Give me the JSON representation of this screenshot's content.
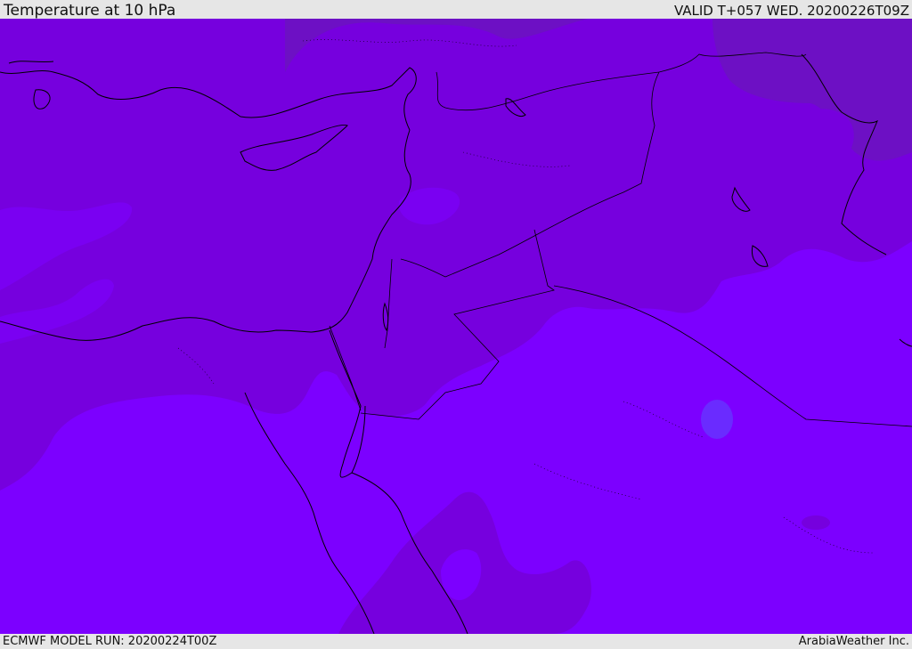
{
  "header": {
    "title": "Temperature at 10 hPa",
    "valid": "VALID T+057 WED. 20200226T09Z"
  },
  "footer": {
    "model_run": "ECMWF MODEL RUN: 20200224T00Z",
    "credit": "ArabiaWeather Inc."
  },
  "map": {
    "variable": "temperature",
    "level": "10 hPa",
    "colors": {
      "coldest": "#7600de",
      "cold": "#7a00f2",
      "mid": "#7c00ff",
      "warmest_patch": "#6d10c4",
      "light_patch": "#6a2bff",
      "coastline": "#000000",
      "border": "#000000"
    }
  }
}
